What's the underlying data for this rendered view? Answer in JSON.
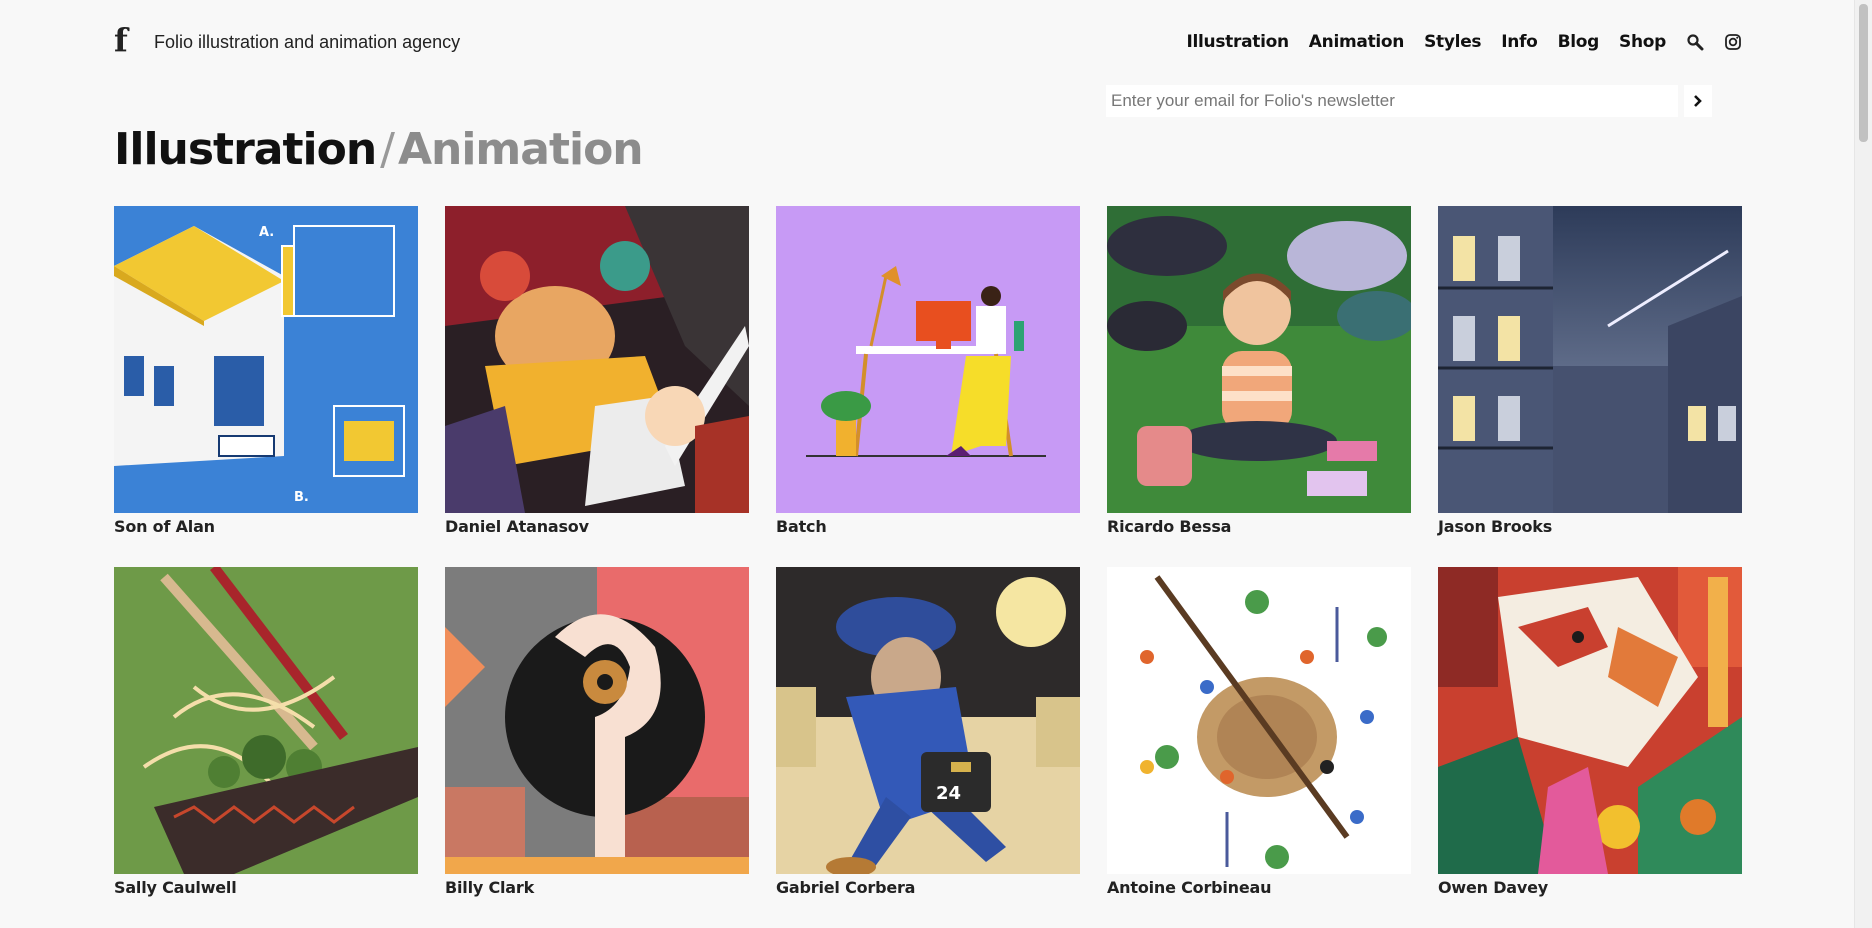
{
  "header": {
    "logo": "f",
    "tagline": "Folio illustration and animation agency",
    "nav": [
      "Illustration",
      "Animation",
      "Styles",
      "Info",
      "Blog",
      "Shop"
    ],
    "icons": [
      "search-icon",
      "instagram-icon"
    ]
  },
  "newsletter": {
    "placeholder": "Enter your email for Folio's newsletter",
    "submit_icon": "chevron-right-icon"
  },
  "page_title": {
    "active": "Illustration",
    "separator": "/",
    "inactive": "Animation"
  },
  "artists": [
    {
      "name": "Son of Alan"
    },
    {
      "name": "Daniel Atanasov"
    },
    {
      "name": "Batch"
    },
    {
      "name": "Ricardo Bessa"
    },
    {
      "name": "Jason Brooks"
    },
    {
      "name": "Sally Caulwell"
    },
    {
      "name": "Billy Clark"
    },
    {
      "name": "Gabriel Corbera"
    },
    {
      "name": "Antoine Corbineau"
    },
    {
      "name": "Owen Davey"
    }
  ]
}
